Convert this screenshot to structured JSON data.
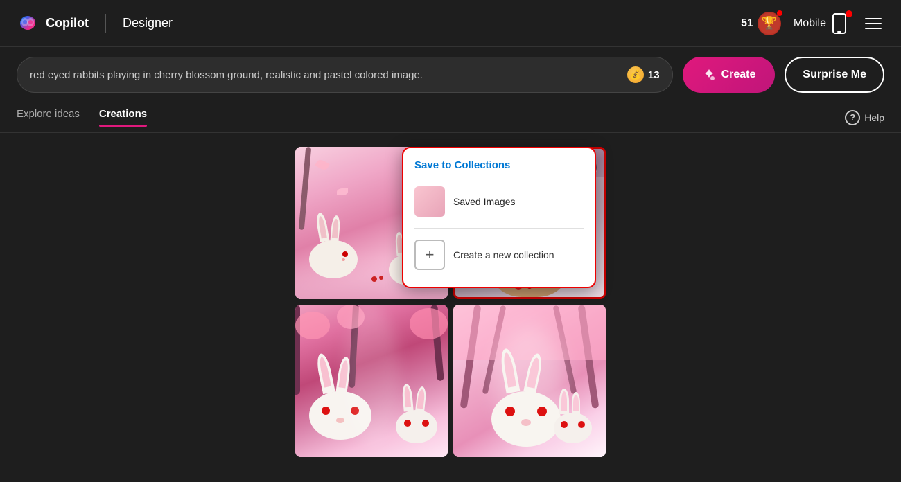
{
  "app": {
    "name": "Copilot",
    "module": "Designer"
  },
  "header": {
    "score": "51",
    "mobile_label": "Mobile",
    "menu_label": "Menu"
  },
  "search": {
    "query": "red eyed rabbits playing in cherry blossom ground, realistic and pastel colored image.",
    "coins": "13",
    "create_label": "Create",
    "surprise_label": "Surprise Me"
  },
  "tabs": [
    {
      "id": "explore",
      "label": "Explore ideas",
      "active": false
    },
    {
      "id": "creations",
      "label": "Creations",
      "active": true
    }
  ],
  "help": {
    "label": "Help"
  },
  "images": [
    {
      "id": 1,
      "alt": "Two rabbits among cherry blossoms"
    },
    {
      "id": 2,
      "alt": "Brown rabbit with red eye among blossoms"
    },
    {
      "id": 3,
      "alt": "White rabbits in pink forest"
    },
    {
      "id": 4,
      "alt": "White bunnies under cherry blossom trees"
    }
  ],
  "popup": {
    "title": "Save to",
    "collections_link": "Collections",
    "saved_images_label": "Saved Images",
    "new_collection_label": "Create a new collection"
  },
  "colors": {
    "accent": "#e0197d",
    "brand": "#e0197d",
    "popup_border": "#cc0000",
    "link_color": "#0078d4"
  }
}
